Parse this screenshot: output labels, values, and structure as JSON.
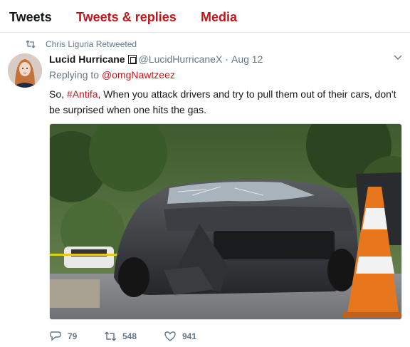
{
  "tabs": [
    {
      "label": "Tweets"
    },
    {
      "label": "Tweets & replies"
    },
    {
      "label": "Media"
    }
  ],
  "accent_color": "#c0171c",
  "retweet_context": "Chris Liguria Retweeted",
  "tweet": {
    "name": "Lucid Hurricane",
    "handle": "@LucidHurricaneX",
    "separator": "·",
    "time": "Aug 12",
    "replying_prefix": "Replying to ",
    "replying_to": "@omgNawtzeez",
    "text_before": "So, ",
    "hashtag": "#Antifa",
    "text_after": ", When you attack drivers and try to pull them out of their cars, don't be surprised when one hits the gas.",
    "media_icon": "photo-of-damaged-car",
    "counts": {
      "replies": "79",
      "retweets": "548",
      "likes": "941"
    }
  }
}
